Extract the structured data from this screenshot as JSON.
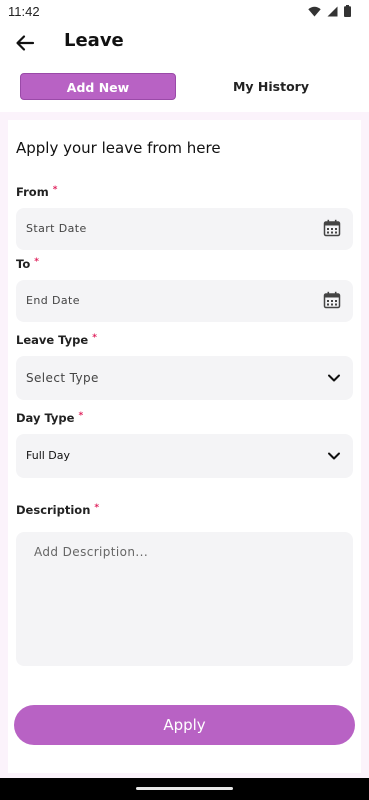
{
  "status_bar": {
    "time": "11:42"
  },
  "app_bar": {
    "title": "Leave"
  },
  "tabs": {
    "add_new": "Add New",
    "history": "My History"
  },
  "form": {
    "heading": "Apply your leave from here",
    "required_mark": "*",
    "from": {
      "label": "From",
      "placeholder": "Start Date"
    },
    "to": {
      "label": "To",
      "placeholder": "End Date"
    },
    "leave_type": {
      "label": "Leave Type",
      "placeholder": "Select Type"
    },
    "day_type": {
      "label": "Day Type",
      "value": "Full Day"
    },
    "description": {
      "label": "Description",
      "placeholder": "Add Description..."
    },
    "submit_label": "Apply"
  },
  "colors": {
    "accent": "#b862c4",
    "field_bg": "#f4f4f6",
    "required": "#e0245e"
  }
}
